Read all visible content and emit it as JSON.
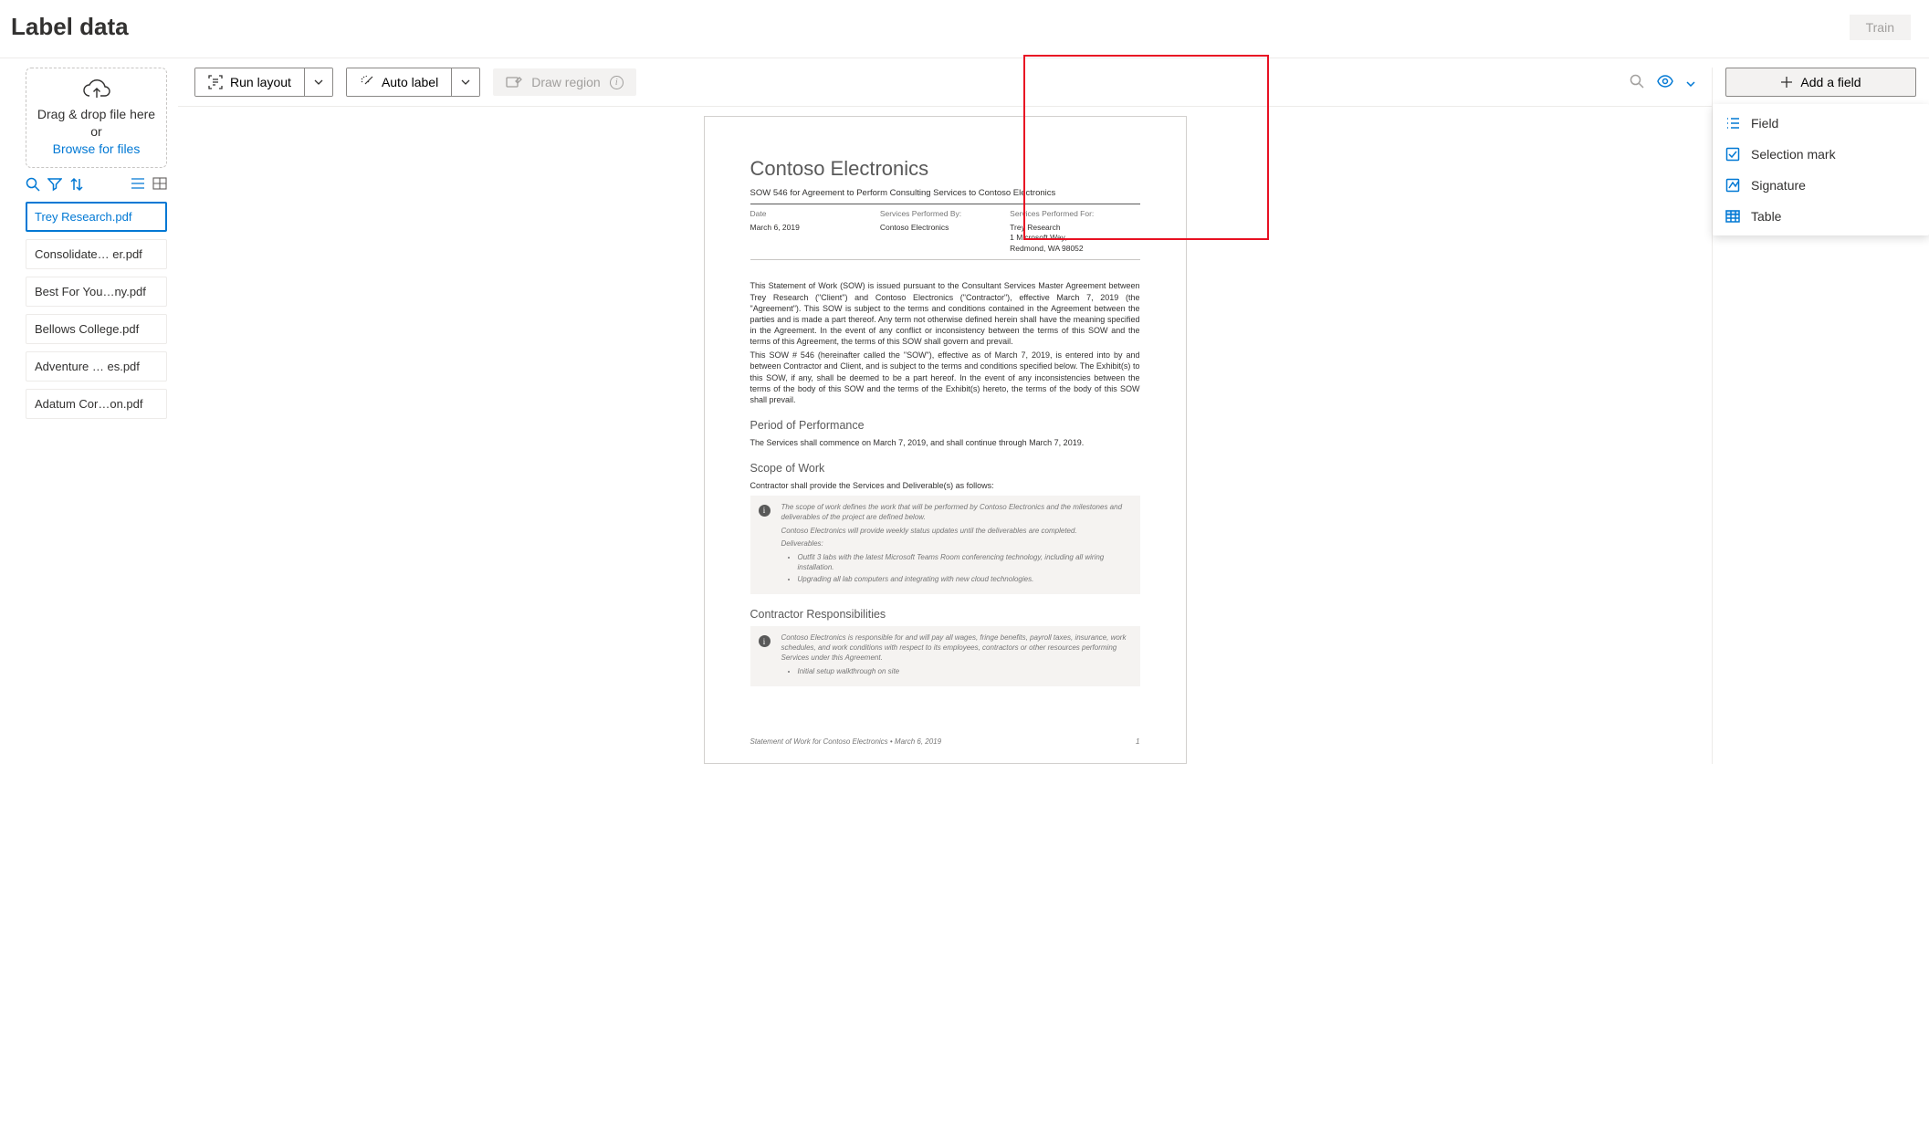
{
  "header": {
    "title": "Label data",
    "train": "Train"
  },
  "sidebar": {
    "drop1": "Drag & drop file here or",
    "drop2": "Browse for files",
    "files": [
      "Trey Research.pdf",
      "Consolidate…  er.pdf",
      "Best For You…ny.pdf",
      "Bellows College.pdf",
      "Adventure …  es.pdf",
      "Adatum Cor…on.pdf"
    ]
  },
  "toolbar": {
    "runLayout": "Run layout",
    "autoLabel": "Auto label",
    "drawRegion": "Draw region",
    "addField": "Add a field"
  },
  "dropdown": {
    "field": "Field",
    "selectionMark": "Selection mark",
    "signature": "Signature",
    "table": "Table"
  },
  "doc": {
    "title": "Contoso Electronics",
    "sub": "SOW 546 for Agreement to Perform Consulting Services to Contoso Electronics",
    "m1l": "Date",
    "m1v": "March 6, 2019",
    "m2l": "Services Performed By:",
    "m2v": "Contoso Electronics",
    "m3l": "Services Performed For:",
    "m3v1": "Trey Research",
    "m3v2": "1 Microsoft Way,",
    "m3v3": "Redmond, WA 98052",
    "p1": "This Statement of Work (SOW) is issued pursuant to the Consultant Services Master Agreement between Trey Research (\"Client\") and Contoso Electronics (\"Contractor\"), effective March 7, 2019 (the \"Agreement\"). This SOW is subject to the terms and conditions contained in the Agreement between the parties and is made a part thereof. Any term not otherwise defined herein shall have the meaning specified in the Agreement. In the event of any conflict or inconsistency between the terms of this SOW and the terms of this Agreement, the terms of this SOW shall govern and prevail.",
    "p2": "This SOW # 546 (hereinafter called the \"SOW\"), effective as of March 7, 2019, is entered into by and between Contractor and Client, and is subject to the terms and conditions specified below. The Exhibit(s) to this SOW, if any, shall be deemed to be a part hereof. In the event of any inconsistencies between the terms of the body of this SOW and the terms of the Exhibit(s) hereto, the terms of the body of this SOW shall prevail.",
    "h2a": "Period of Performance",
    "pa": "The Services shall commence on March 7, 2019, and shall continue through March 7, 2019.",
    "h2b": "Scope of Work",
    "pb": "Contractor shall provide the Services and Deliverable(s) as follows:",
    "c1": "The scope of work defines the work that will be performed by Contoso Electronics and the milestones and deliverables of the project are defined below.",
    "c2": "Contoso Electronics will provide weekly status updates until the deliverables are completed.",
    "c3": "Deliverables:",
    "c4": "Outfit 3 labs with the latest Microsoft Teams Room conferencing technology, including all wiring installation.",
    "c5": "Upgrading all lab computers and integrating with new cloud technologies.",
    "h2c": "Contractor Responsibilities",
    "c6": "Contoso Electronics is responsible for and will pay all wages, fringe benefits, payroll taxes, insurance, work schedules, and work conditions with respect to its employees, contractors or other resources performing Services under this Agreement.",
    "c7": "Initial setup walkthrough on site",
    "footL": "Statement of Work for Contoso Electronics • March 6, 2019",
    "footR": "1"
  }
}
